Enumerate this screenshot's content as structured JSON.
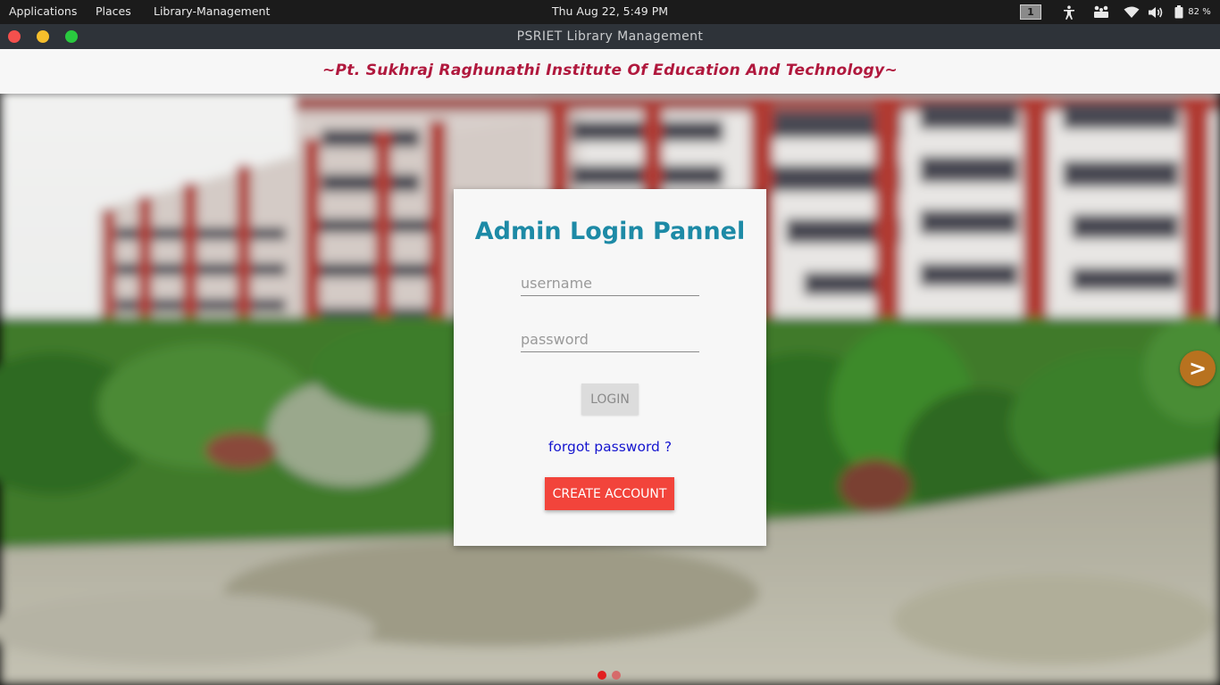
{
  "topbar": {
    "applications": "Applications",
    "places": "Places",
    "active_app": "Library-Management",
    "clock": "Thu Aug 22,  5:49 PM",
    "workspace": "1",
    "battery_percent": "82 %"
  },
  "window": {
    "title": "PSRIET Library Management"
  },
  "header": {
    "institute": "~Pt. Sukhraj Raghunathi Institute Of Education And Technology~"
  },
  "login": {
    "title": "Admin Login Pannel",
    "username_placeholder": "username",
    "password_placeholder": "password",
    "username_value": "",
    "password_value": "",
    "login_label": "LOGIN",
    "forgot_label": "forgot password ?",
    "create_label": "CREATE ACCOUNT"
  },
  "carousel": {
    "next_label": ">",
    "active_slide": 1,
    "total_slides": 2
  },
  "colors": {
    "institute_text": "#b0183d",
    "title_text": "#1d8aa6",
    "create_button": "#f2443b",
    "link": "#1515cf",
    "next_arrow": "#b8721f"
  },
  "icons": [
    "accessibility-icon",
    "network-share-icon",
    "wifi-icon",
    "volume-icon",
    "battery-icon"
  ]
}
